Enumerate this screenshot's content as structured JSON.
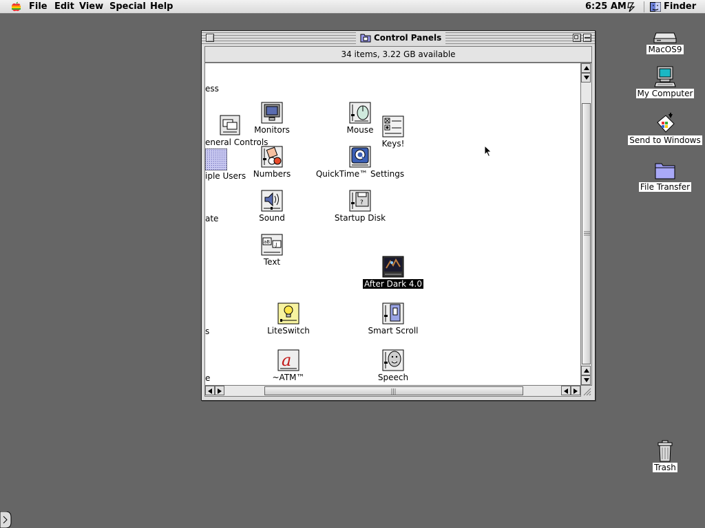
{
  "menubar": {
    "items": [
      "File",
      "Edit",
      "View",
      "Special",
      "Help"
    ],
    "clock": "6:25 AM",
    "app": "Finder"
  },
  "desktop_icons": [
    {
      "label": "MacOS9",
      "icon": "hard-disk-icon"
    },
    {
      "label": "My Computer",
      "icon": "computer-icon"
    },
    {
      "label": "Send to Windows",
      "icon": "send-to-windows-icon"
    },
    {
      "label": "File Transfer",
      "icon": "folder-icon"
    },
    {
      "label": "Trash",
      "icon": "trash-icon"
    }
  ],
  "window": {
    "title": "Control Panels",
    "info": "34 items, 3.22 GB available",
    "clipped_labels": [
      "ess",
      "eneral Controls",
      "iple Users",
      "ate",
      "s",
      "e"
    ],
    "icons": [
      {
        "label": "Monitors",
        "icon": "monitors-icon"
      },
      {
        "label": "Mouse",
        "icon": "mouse-icon"
      },
      {
        "label": "Keys!",
        "icon": "keys-icon"
      },
      {
        "label": "Numbers",
        "icon": "numbers-icon"
      },
      {
        "label": "QuickTime™ Settings",
        "icon": "quicktime-icon"
      },
      {
        "label": "Sound",
        "icon": "sound-icon"
      },
      {
        "label": "Startup Disk",
        "icon": "startup-disk-icon"
      },
      {
        "label": "Text",
        "icon": "text-icon"
      },
      {
        "label": "After Dark 4.0",
        "icon": "after-dark-icon",
        "selected": true
      },
      {
        "label": "LiteSwitch",
        "icon": "liteswitch-icon"
      },
      {
        "label": "Smart Scroll",
        "icon": "smart-scroll-icon"
      },
      {
        "label": "~ATM™",
        "icon": "atm-icon"
      },
      {
        "label": "Speech",
        "icon": "speech-icon"
      }
    ]
  },
  "colors": {
    "desktop": "#666666",
    "window_bg": "#dddddd",
    "selection": "#000000"
  }
}
